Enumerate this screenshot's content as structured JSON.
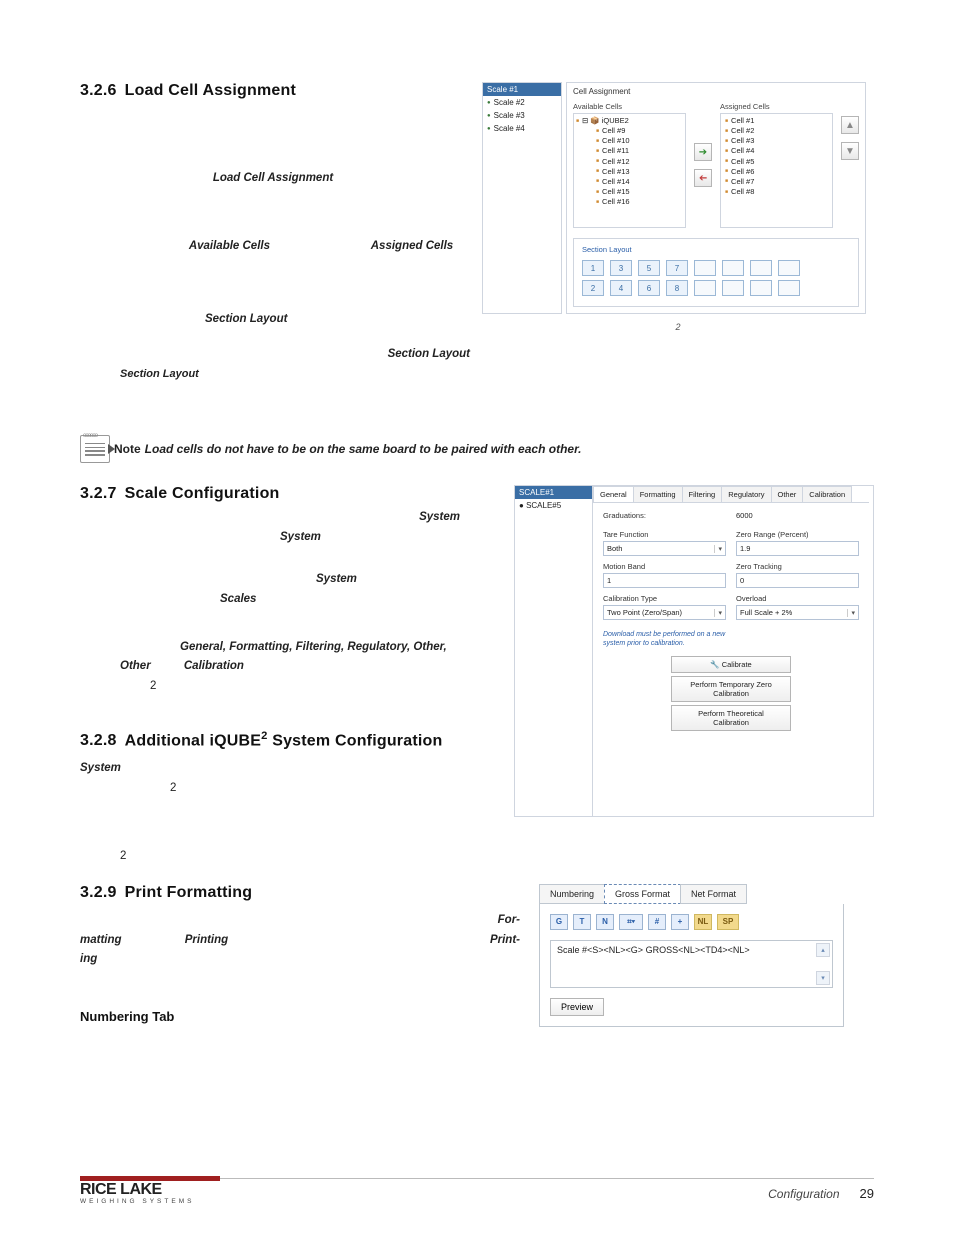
{
  "s326": {
    "heading_num": "3.2.6",
    "heading_txt": "Load Cell Assignment",
    "para_style_lca": "Load Cell Assignment",
    "para_style_avail": "Available Cells",
    "para_style_assigned": "Assigned Cells",
    "para_style_seclayout": "Section Layout",
    "fig": {
      "scales": [
        "Scale #1",
        "Scale #2",
        "Scale #3",
        "Scale #4"
      ],
      "title": "Cell Assignment",
      "avail_lbl": "Available Cells",
      "assigned_lbl": "Assigned Cells",
      "tree_root": "iQUBE2",
      "avail": [
        "Cell #9",
        "Cell #10",
        "Cell #11",
        "Cell #12",
        "Cell #13",
        "Cell #14",
        "Cell #15",
        "Cell #16"
      ],
      "assigned": [
        "Cell #1",
        "Cell #2",
        "Cell #3",
        "Cell #4",
        "Cell #5",
        "Cell #6",
        "Cell #7",
        "Cell #8"
      ],
      "seclayout_title": "Section Layout",
      "row1": [
        "1",
        "3",
        "5",
        "7",
        "",
        "",
        "",
        ""
      ],
      "row2": [
        "2",
        "4",
        "6",
        "8",
        "",
        "",
        "",
        ""
      ],
      "figcap_sup": "2"
    },
    "note_lbl": "Note",
    "note_txt": "Load cells do not have to be on the same board to be paired with each other."
  },
  "s327": {
    "heading_num": "3.2.7",
    "heading_txt": "Scale Configuration",
    "w_system": "System",
    "w_scales": "Scales",
    "w_tabs": "General, Formatting, Filtering, Regulatory, Other,",
    "w_cal": "Calibration",
    "fig": {
      "scales": [
        "SCALE#1",
        "SCALE#5"
      ],
      "tabs": [
        "General",
        "Formatting",
        "Filtering",
        "Regulatory",
        "Other",
        "Calibration"
      ],
      "grads_lbl": "Graduations:",
      "grads_val": "6000",
      "tare_lbl": "Tare Function",
      "tare_val": "Both",
      "zrange_lbl": "Zero Range (Percent)",
      "zrange_val": "1.9",
      "motion_lbl": "Motion Band",
      "motion_val": "1",
      "ztrack_lbl": "Zero Tracking",
      "ztrack_val": "0",
      "caltype_lbl": "Calibration Type",
      "caltype_val": "Two Point (Zero/Span)",
      "over_lbl": "Overload",
      "over_val": "Full Scale + 2%",
      "hint": "Download must be performed on a new system prior to calibration.",
      "btn1": "Calibrate",
      "btn2": "Perform Temporary Zero Calibration",
      "btn3": "Perform Theoretical Calibration"
    },
    "sup2": "2"
  },
  "s328": {
    "heading_num": "3.2.8",
    "heading_txt_pre": "Additional iQUBE",
    "heading_txt_post": " System Configuration",
    "w_system": "System",
    "sup2": "2"
  },
  "s329": {
    "heading_num": "3.2.9",
    "heading_txt": "Print Formatting",
    "w_formatting": "For-",
    "w_formatting2": "matting",
    "w_printing": "Printing",
    "w_printing2": "Print-",
    "w_printing3": "ing",
    "numbering_h": "Numbering Tab",
    "fig": {
      "tabs": [
        "Numbering",
        "Gross Format",
        "Net Format"
      ],
      "icons": [
        "G",
        "T",
        "N",
        "⌗",
        "#",
        "+",
        "NL",
        "SP"
      ],
      "textarea": "Scale #<S><NL><G> GROSS<NL><TD4><NL>",
      "preview": "Preview"
    }
  },
  "footer": {
    "logo_top": "RICE LAKE",
    "logo_bot": "WEIGHING SYSTEMS",
    "label": "Configuration",
    "page": "29"
  }
}
